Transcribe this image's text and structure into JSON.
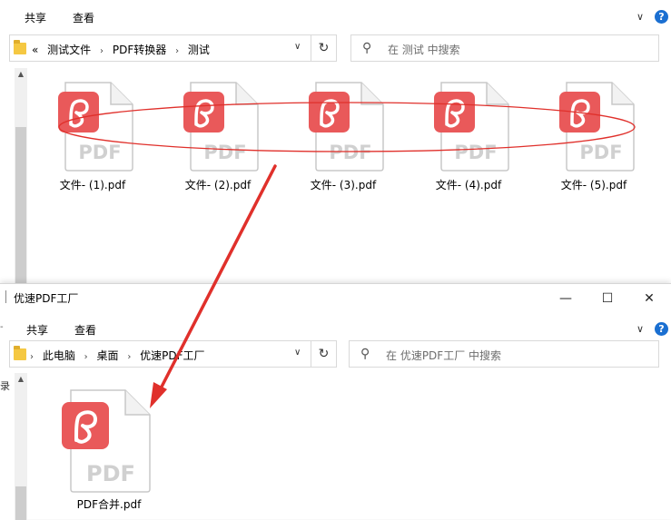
{
  "window_top": {
    "ribbon": {
      "tab_share": "共享",
      "tab_view": "查看",
      "help": "?"
    },
    "address": {
      "prefix": "«",
      "crumbs": [
        "测试文件",
        "PDF转换器",
        "测试"
      ]
    },
    "search_placeholder": "在 测试 中搜索",
    "files": [
      {
        "name": "文件- (1).pdf",
        "label": "PDF"
      },
      {
        "name": "文件- (2).pdf",
        "label": "PDF"
      },
      {
        "name": "文件- (3).pdf",
        "label": "PDF"
      },
      {
        "name": "文件- (4).pdf",
        "label": "PDF"
      },
      {
        "name": "文件- (5).pdf",
        "label": "PDF"
      }
    ]
  },
  "window_bottom": {
    "title": "优速PDF工厂",
    "controls": {
      "minimize": "—",
      "maximize": "☐",
      "close": "✕"
    },
    "ribbon": {
      "tab_share": "共享",
      "tab_view": "查看",
      "help": "?"
    },
    "address": {
      "crumbs": [
        "此电脑",
        "桌面",
        "优速PDF工厂"
      ]
    },
    "search_placeholder": "在 优速PDF工厂 中搜索",
    "files": [
      {
        "name": "PDF合并.pdf",
        "label": "PDF"
      }
    ],
    "left_edge_text": "录"
  },
  "colors": {
    "pdf_red": "#e9595a",
    "annotation_red": "#e0302b",
    "help_blue": "#1a6fd1"
  }
}
